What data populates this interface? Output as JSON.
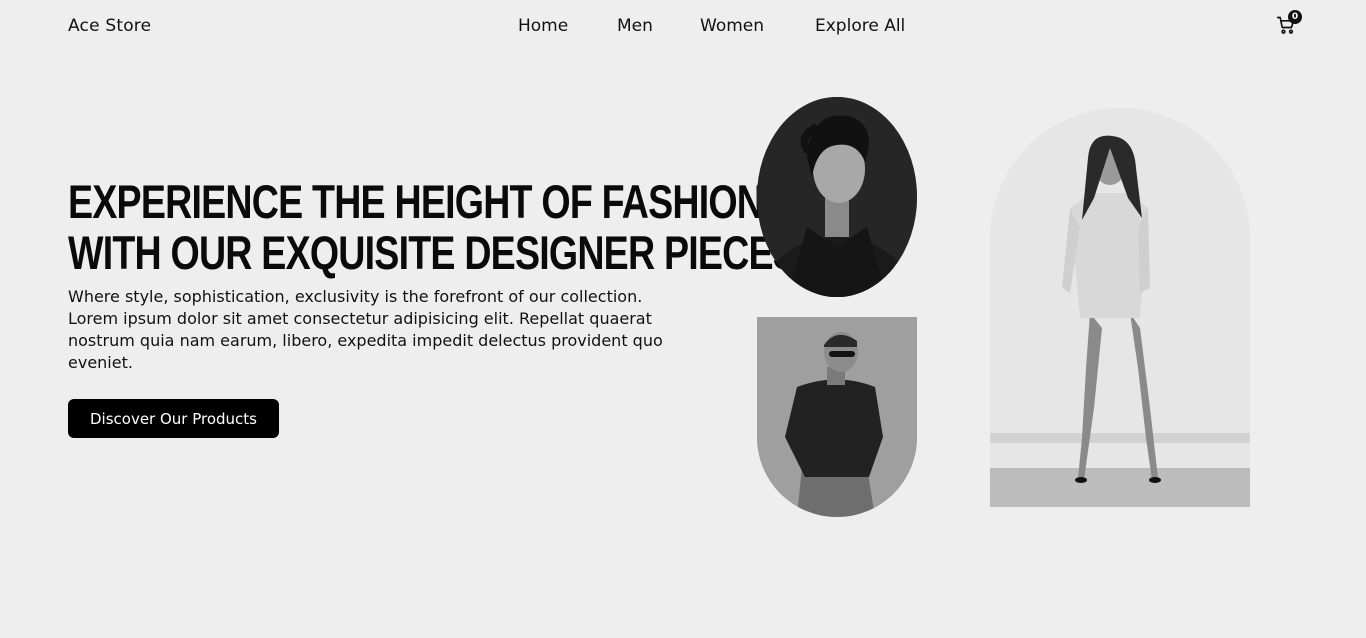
{
  "nav": {
    "brand": "Ace Store",
    "links": [
      "Home",
      "Men",
      "Women",
      "Explore All"
    ],
    "cart_count": "0",
    "cart_icon": "cart-icon"
  },
  "hero": {
    "title_line1": "EXPERIENCE THE HEIGHT OF FASHION",
    "title_line2": "WITH OUR EXQUISITE DESIGNER PIECES.",
    "description": "Where style, sophistication, exclusivity is the forefront of our collection. Lorem ipsum dolor sit amet consectetur adipisicing elit. Repellat quaerat nostrum quia nam earum, libero, expedita impedit delectus provident quo eveniet.",
    "cta_label": "Discover Our Products"
  },
  "gallery": {
    "images": [
      "male-model-portrait",
      "male-model-sunglasses",
      "female-model-white-blazer"
    ]
  },
  "colors": {
    "background": "#eeeeee",
    "text": "#111111",
    "button": "#000000"
  }
}
